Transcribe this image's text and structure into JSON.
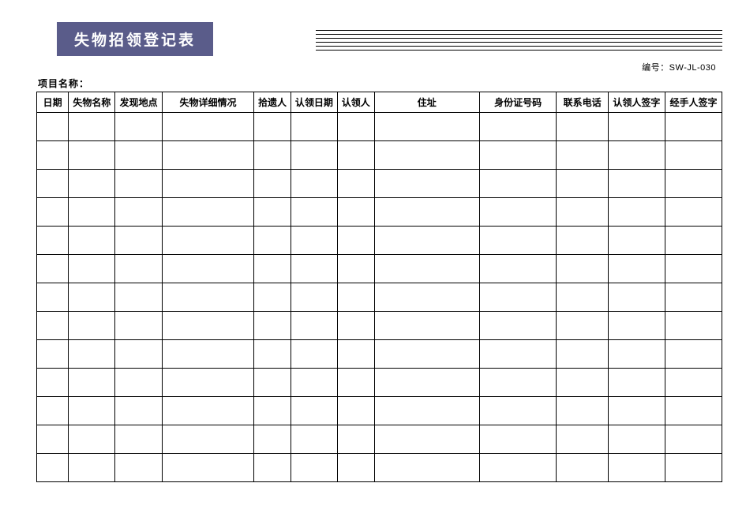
{
  "title": "失物招领登记表",
  "doc_no_label": "编号：",
  "doc_no": "SW-JL-030",
  "project_label": "项目名称：",
  "columns": [
    "日期",
    "失物名称",
    "发现地点",
    "失物详细情况",
    "拾遗人",
    "认领日期",
    "认领人",
    "住址",
    "身份证号码",
    "联系电话",
    "认领人签字",
    "经手人签字"
  ],
  "row_count": 13
}
